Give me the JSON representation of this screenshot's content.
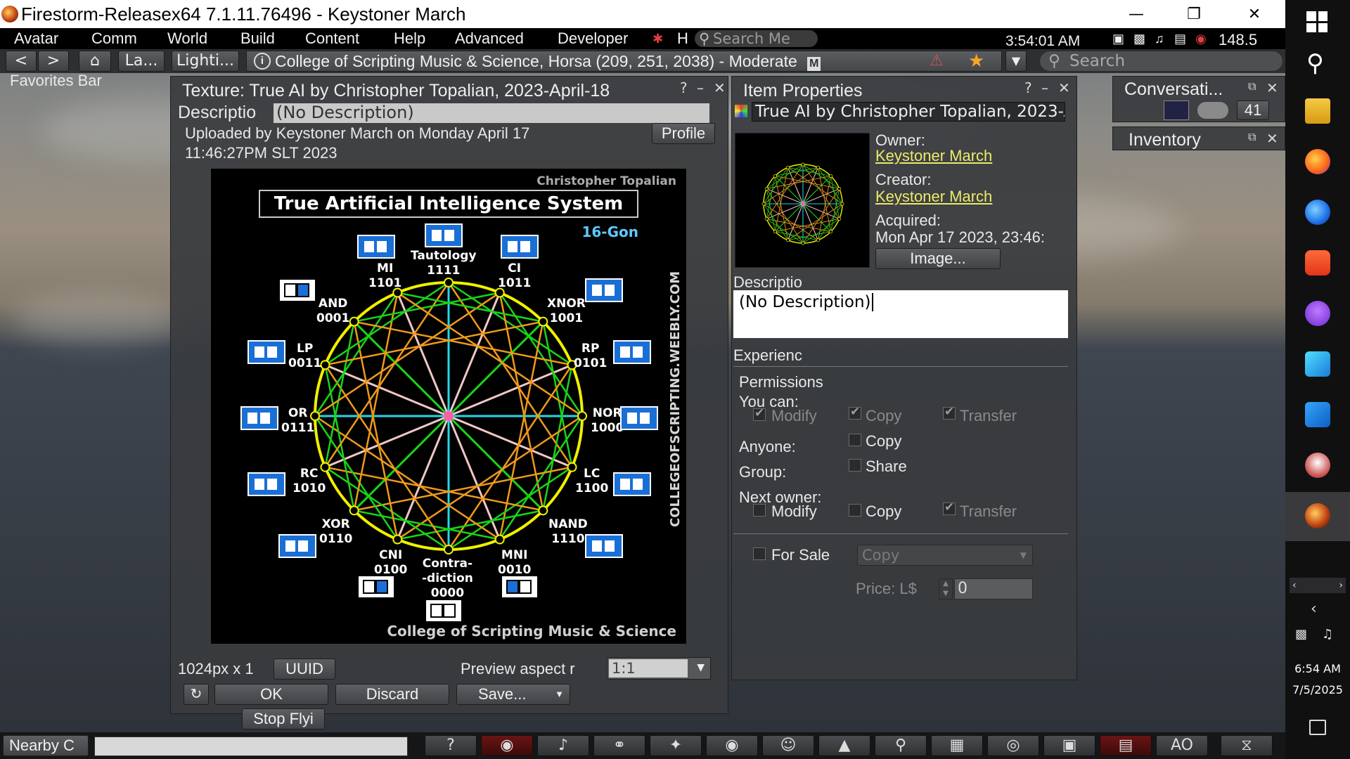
{
  "window": {
    "title": "Firestorm-Releasex64 7.1.11.76496 - Keystoner March",
    "minimize": "—",
    "restore": "❐",
    "close": "✕"
  },
  "menu": {
    "items": [
      "Avatar",
      "Comm",
      "World",
      "Build",
      "Content",
      "Help",
      "Advanced",
      "Developer"
    ],
    "search_placeholder": "Search Me",
    "h_label": "H",
    "clock": "3:54:01 AM",
    "fps": "148.5"
  },
  "nav": {
    "back": "<",
    "forward": ">",
    "home": "⌂",
    "landmarks_label": "La...",
    "lighting_label": "Lighti...",
    "location": "College of Scripting Music & Science, Horsa (209, 251, 2038) - Moderate",
    "maturity_badge": "M",
    "search_placeholder": "Search",
    "favorites_bar": "Favorites Bar"
  },
  "texture_floater": {
    "title": "Texture: True AI by Christopher Topalian, 2023-April-18",
    "description_label": "Descriptio",
    "description_value": "(No Description)",
    "uploaded_line1": "Uploaded by Keystoner March on Monday April 17",
    "uploaded_line2": "11:46:27PM SLT 2023",
    "profile_button": "Profile",
    "dimensions": "1024px x 1",
    "uuid_button": "UUID",
    "preview_aspect_label": "Preview aspect r",
    "preview_aspect_value": "1:1",
    "ok_button": "OK",
    "discard_button": "Discard",
    "save_button": "Save...",
    "stop_flying_button": "Stop Flyi"
  },
  "texture_image": {
    "author": "Christopher Topalian",
    "title": "True Artificial Intelligence System",
    "gon": "16-Gon",
    "site": "COLLEGEOFSCRIPTING.WEEBLY.COM",
    "footer": "College of Scripting Music & Science",
    "labels": {
      "tautology": "Tautology\n1111",
      "mi": "MI\n1101",
      "ci": "CI\n1011",
      "and": "AND\n0001",
      "xnor": "XNOR\n1001",
      "lp": "LP\n0011",
      "rp": "RP\n0101",
      "or": "OR\n0111",
      "nor": "NOR\n1000",
      "rc": "RC\n1010",
      "lc": "LC\n1100",
      "xor": "XOR\n0110",
      "nand": "NAND\n1110",
      "cni": "CNI\n0100",
      "mni": "MNI\n0010",
      "contradiction": "Contra-\n-diction\n0000"
    },
    "colors": {
      "ring": "#f0f000",
      "green": "#19d419",
      "orange": "#f09a1a",
      "cyan": "#22d8e8",
      "pink": "#f2c6c6",
      "box_blue": "#1a6fd6",
      "center": "#ff5cae"
    }
  },
  "item_properties": {
    "title": "Item Properties",
    "item_name": "True AI by Christopher Topalian, 2023-A",
    "owner_label": "Owner:",
    "owner_name": "Keystoner March",
    "creator_label": "Creator:",
    "creator_name": "Keystoner March",
    "acquired_label": "Acquired:",
    "acquired_value": "Mon Apr 17 2023, 23:46:",
    "image_button": "Image...",
    "description_label": "Descriptio",
    "description_value": "(No Description)",
    "experience_label": "Experienc",
    "permissions_label": "Permissions",
    "you_can_label": "You can:",
    "modify": "Modify",
    "copy": "Copy",
    "transfer": "Transfer",
    "anyone_label": "Anyone:",
    "group_label": "Group:",
    "share": "Share",
    "next_owner_label": "Next owner:",
    "for_sale_label": "For Sale",
    "sale_type": "Copy",
    "price_label": "Price: L$",
    "price_value": "0"
  },
  "conversations": {
    "title": "Conversati...",
    "count": "41"
  },
  "inventory": {
    "title": "Inventory"
  },
  "bottombar": {
    "nearby_chat": "Nearby C",
    "ao_label": "AO",
    "icons": [
      "help-icon",
      "chat-icon",
      "voice-icon",
      "speak-icon",
      "move-icon",
      "view-icon",
      "people-icon",
      "appearance-icon",
      "search-icon",
      "map-icon",
      "places-icon",
      "snapshot-icon",
      "inventory-icon",
      "ao-icon",
      "mute-icon"
    ]
  },
  "taskbar": {
    "time": "6:54 AM",
    "date": "7/5/2025",
    "icons": [
      "windows-start-icon",
      "search-icon",
      "file-explorer-icon",
      "firefox-icon",
      "firefox-nightly-icon",
      "brave-icon",
      "tor-browser-icon",
      "windsurf-icon",
      "vscode-icon",
      "paint-icon",
      "firestorm-icon"
    ]
  }
}
